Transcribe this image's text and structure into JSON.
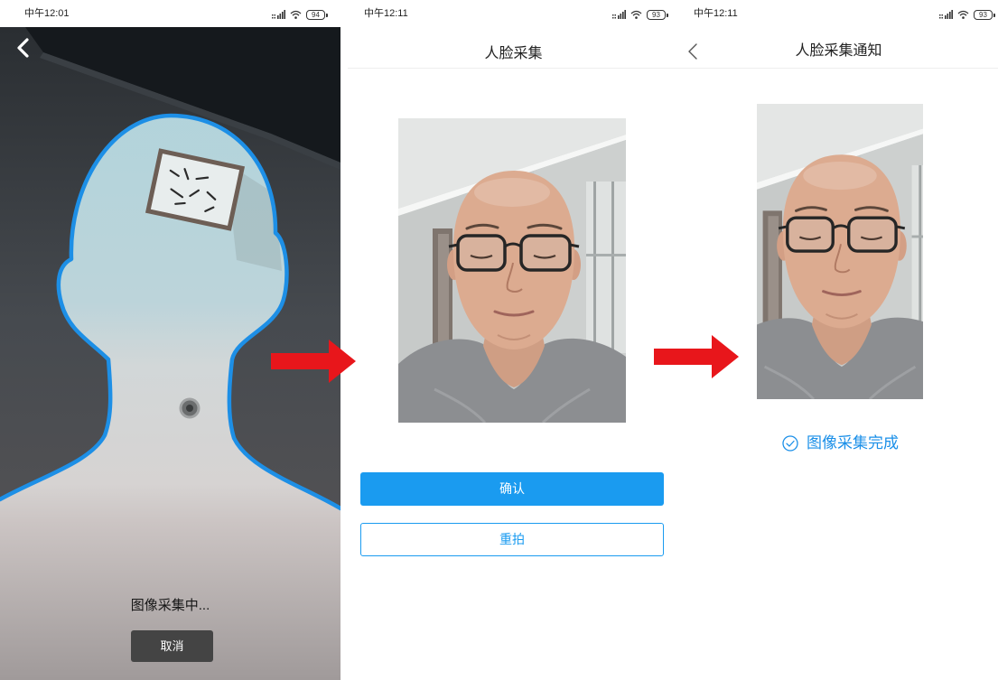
{
  "capture_screen": {
    "status_bar": {
      "time": "中午12:01",
      "battery": "94"
    },
    "status_text": "图像采集中...",
    "cancel_label": "取消"
  },
  "confirm_screen": {
    "status_bar": {
      "time": "中午12:11",
      "battery": "93"
    },
    "title": "人脸采集",
    "confirm_label": "确认",
    "retake_label": "重拍"
  },
  "result_screen": {
    "status_bar": {
      "time": "中午12:11",
      "battery": "93"
    },
    "title": "人脸采集通知",
    "result_text": "图像采集完成"
  },
  "icons": {
    "back": "chevron-left-icon",
    "signal": "signal-icon",
    "wifi": "wifi-icon",
    "battery": "battery-icon",
    "success": "check-circle-icon",
    "flow_arrow": "arrow-right-icon"
  },
  "colors": {
    "accent": "#1a9bf0",
    "face_outline": "#1d8fe6",
    "flow_arrow": "#e8161b",
    "cancel_button": "#444444"
  }
}
